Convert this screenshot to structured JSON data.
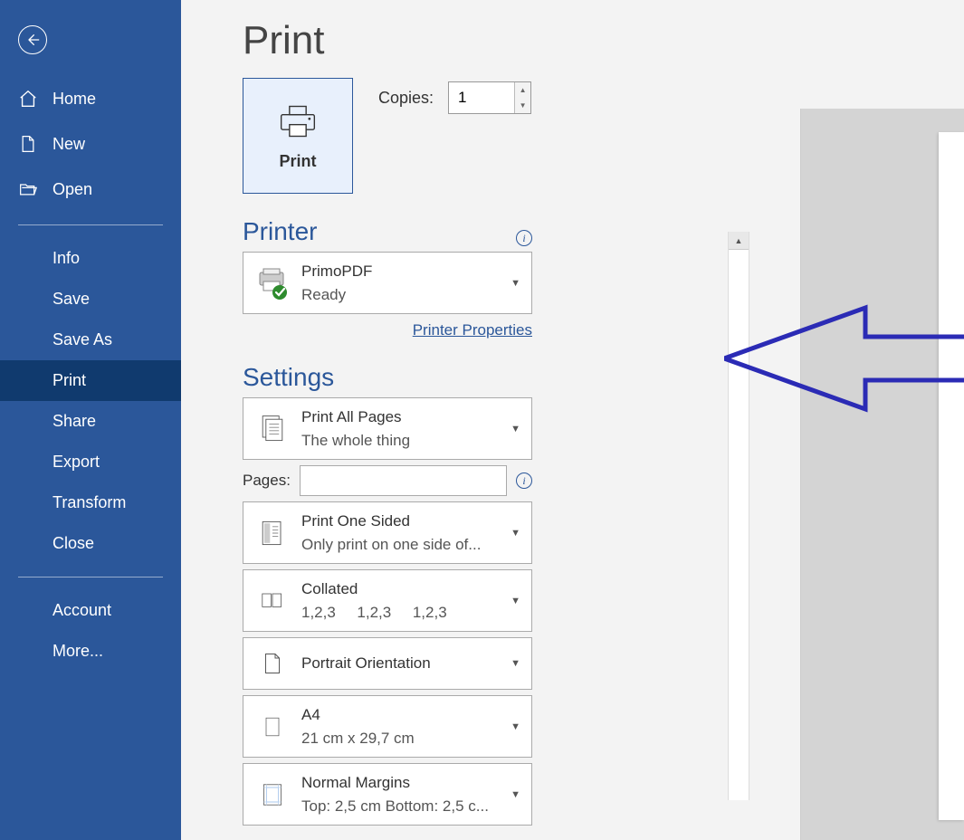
{
  "page_title": "Print",
  "sidebar": {
    "top": [
      {
        "label": "Home"
      },
      {
        "label": "New"
      },
      {
        "label": "Open"
      }
    ],
    "mid": [
      {
        "label": "Info"
      },
      {
        "label": "Save"
      },
      {
        "label": "Save As"
      },
      {
        "label": "Print",
        "selected": true
      },
      {
        "label": "Share"
      },
      {
        "label": "Export"
      },
      {
        "label": "Transform"
      },
      {
        "label": "Close"
      }
    ],
    "bottom": [
      {
        "label": "Account"
      },
      {
        "label": "More..."
      }
    ]
  },
  "print_tile_label": "Print",
  "copies": {
    "label": "Copies:",
    "value": "1"
  },
  "printer_section": "Printer",
  "printer": {
    "name": "PrimoPDF",
    "status": "Ready"
  },
  "printer_properties": "Printer Properties",
  "settings_section": "Settings",
  "pages_label": "Pages:",
  "pages_value": "",
  "settings": [
    {
      "title": "Print All Pages",
      "sub": "The whole thing"
    },
    {
      "title": "Print One Sided",
      "sub": "Only print on one side of..."
    },
    {
      "title": "Collated",
      "sub": "1,2,3     1,2,3     1,2,3"
    },
    {
      "title": "Portrait Orientation",
      "sub": ""
    },
    {
      "title": "A4",
      "sub": "21 cm x 29,7 cm"
    },
    {
      "title": "Normal Margins",
      "sub": "Top: 2,5 cm Bottom: 2,5 c..."
    }
  ]
}
